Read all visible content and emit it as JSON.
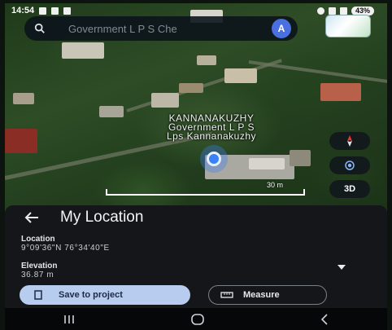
{
  "status_bar": {
    "time": "14:54",
    "battery": "43%"
  },
  "search": {
    "placeholder": "Government L P S Che",
    "avatar_letter": "A"
  },
  "map": {
    "place_label_lines": [
      "KANNANAKUZHY",
      "Government L P S",
      "Lps Kannanakuzhy"
    ],
    "scale_label": "30 m",
    "btn_3d": "3D"
  },
  "sheet": {
    "title": "My Location",
    "location_label": "Location",
    "location_value": "9°09'36\"N 76°34'40\"E",
    "elevation_label": "Elevation",
    "elevation_value": "36.87 m",
    "save_label": "Save to project",
    "measure_label": "Measure"
  },
  "colors": {
    "accent_blue": "#3b82f6",
    "save_button_bg": "#b8ccf0",
    "sheet_bg": "#141619"
  },
  "icons": [
    "search-icon",
    "compass-icon",
    "my-location-icon",
    "back-arrow-icon",
    "bookmark-icon",
    "ruler-icon",
    "chevron-down-icon",
    "recents-icon",
    "home-icon",
    "back-icon",
    "layers-icon"
  ]
}
